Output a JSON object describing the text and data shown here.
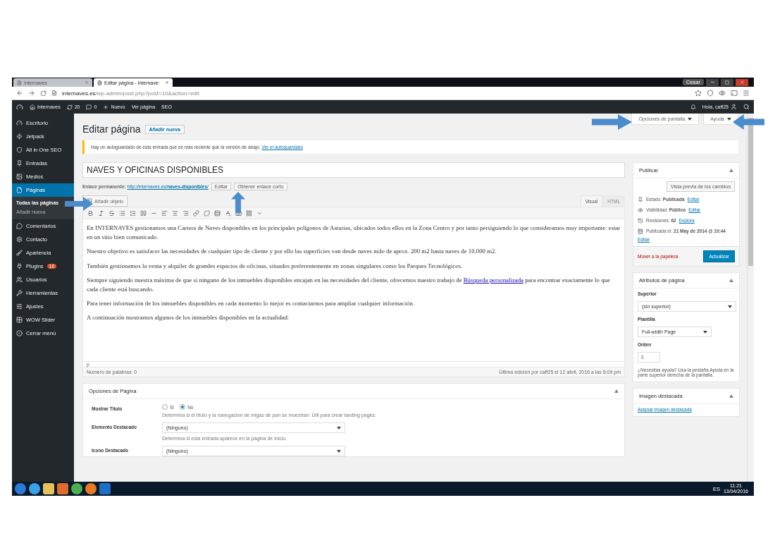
{
  "browser": {
    "tabs": [
      {
        "label": "Internaves",
        "selected": false
      },
      {
        "label": "Editar página - Internave:",
        "selected": true
      }
    ],
    "user": "Cesar",
    "address": {
      "host": "internaves.es",
      "path": "/wp-admin/post.php?post=10&action=edit"
    }
  },
  "admin_bar": {
    "site": "Internaves",
    "updates": "20",
    "comments": "0",
    "new": "Nuevo",
    "view": "Ver página",
    "seo": "SEO",
    "greeting": "Hola, caff25"
  },
  "sidebar": {
    "items": [
      {
        "label": "Escritorio",
        "selected": false
      },
      {
        "label": "Jetpack",
        "selected": false
      },
      {
        "label": "All in One SEO",
        "selected": false
      },
      {
        "label": "Entradas",
        "selected": false
      },
      {
        "label": "Medios",
        "selected": false
      },
      {
        "label": "Páginas",
        "selected": true,
        "children": [
          {
            "label": "Todas las páginas",
            "selected": true
          },
          {
            "label": "Añadir nueva",
            "selected": false
          }
        ]
      },
      {
        "label": "Comentarios",
        "selected": false
      },
      {
        "label": "Contacto",
        "selected": false
      },
      {
        "label": "Apariencia",
        "selected": false
      },
      {
        "label": "Plugins",
        "selected": false,
        "badge": "10"
      },
      {
        "label": "Usuarios",
        "selected": false
      },
      {
        "label": "Herramientas",
        "selected": false
      },
      {
        "label": "Ajustes",
        "selected": false
      },
      {
        "label": "WOW Slider",
        "selected": false
      },
      {
        "label": "Cerrar menú",
        "selected": false
      }
    ]
  },
  "screen_tabs": [
    "Opciones de pantalla",
    "Ayuda"
  ],
  "header": {
    "title": "Editar página",
    "add_new": "Añadir nueva"
  },
  "notice": {
    "text": "Hay un autoguardado de esta entrada que es más reciente que la versión de abajo.",
    "link": "Ver el autoguardado"
  },
  "post": {
    "title": "NAVES Y OFICINAS DISPONIBLES",
    "permalink_label": "Enlace permanente:",
    "permalink_base": "http://internaves.es/",
    "permalink_slug": "naves-disponibles",
    "permalink_end": "/",
    "edit_button": "Editar",
    "shortlink_button": "Obtener enlace corto"
  },
  "add_media": "Añadir objeto",
  "editor_tabs": [
    {
      "label": "Visual",
      "selected": true
    },
    {
      "label": "HTML",
      "selected": false
    }
  ],
  "paragraphs": [
    {
      "text": "En INTERNAVES gestionamos una Cartera de Naves disponibles en los principales polígonos de Asturias, ubicados todos ellos en la Zona Centro y por tanto persiguiendo lo que consideramos muy importante: estar en un sitio bien comunicado."
    },
    {
      "text": "Nuestro objetivo es satisfacer las necesidades de cualquier tipo de cliente y por ello las superficies van desde naves nido de aprox. 200 m2 hasta naves de 10.000 m2."
    },
    {
      "text": "También gestionamos la venta y alquiler de grandes espacios de oficinas, situados preferentemente en zonas singulares como los Parques Tecnológicos."
    },
    {
      "text": "Siempre siguiendo nuestra máxima de que si ninguno de los inmuebles disponibles encajan en las necesidades del cliente, ofrecemos nuestro trabajo de",
      "link": "Búsqueda personalizada",
      "after": "para encontrar exactamente lo que cada cliente está buscando."
    },
    {
      "text": "Para tener información de los inmuebles disponibles en cada momento lo mejor es contactarnos para ampliar cualquier información."
    },
    {
      "text": "A continuación mostramos algunos de los inmuebles disponibles en la actualidad:"
    }
  ],
  "editor_footer": {
    "path": "p",
    "word_count": "Número de palabras: 0",
    "last_edit": "Última edición por caff25 el 12 abril, 2016 a las 8:09 pm"
  },
  "page_options": {
    "title": "Opciones de Página",
    "rows": [
      {
        "kind": "radio",
        "label": "Mostrar Título",
        "options": [
          {
            "label": "Sí",
            "selected": false
          },
          {
            "label": "No",
            "selected": true
          }
        ],
        "help": "Determina si el título y la navegación de migas de pan se muestran. Útil para crear landing pages."
      },
      {
        "kind": "select",
        "label": "Elemento Destacado",
        "value": "(Ninguno)",
        "help": "Determina si esta entrada aparece en la página de inicio."
      },
      {
        "kind": "select",
        "label": "Icono Destacado",
        "value": "(Ninguno)"
      }
    ]
  },
  "publish": {
    "title": "Publicar",
    "preview": "Vista previa de los cambios",
    "rows": [
      {
        "text": "Estado: **Publicada**",
        "link": "Editar"
      },
      {
        "text": "Visibilidad: **Público**",
        "link": "Editar"
      },
      {
        "text": "Revisiones: **62**",
        "link": "Explora"
      },
      {
        "text": "Publicada el: **21 May de 2014 @ 10:44**",
        "link": "Editar"
      }
    ],
    "trash": "Mover a la papelera",
    "update": "Actualizar"
  },
  "attributes": {
    "title": "Atributos de página",
    "parent_label": "Superior",
    "parent": "(sin superior)",
    "template_label": "Plantilla",
    "template": "Full-width Page",
    "order_label": "Orden",
    "order": "0",
    "help": "¿Necesitas ayuda? Usa la pestaña Ayuda en la parte superior derecha de la pantalla."
  },
  "featured_image": {
    "title": "Imagen destacada",
    "link": "Asignar imagen destacada"
  },
  "taskbar": {
    "language": "ES",
    "time": "11:21",
    "date": "13/04/2016"
  }
}
